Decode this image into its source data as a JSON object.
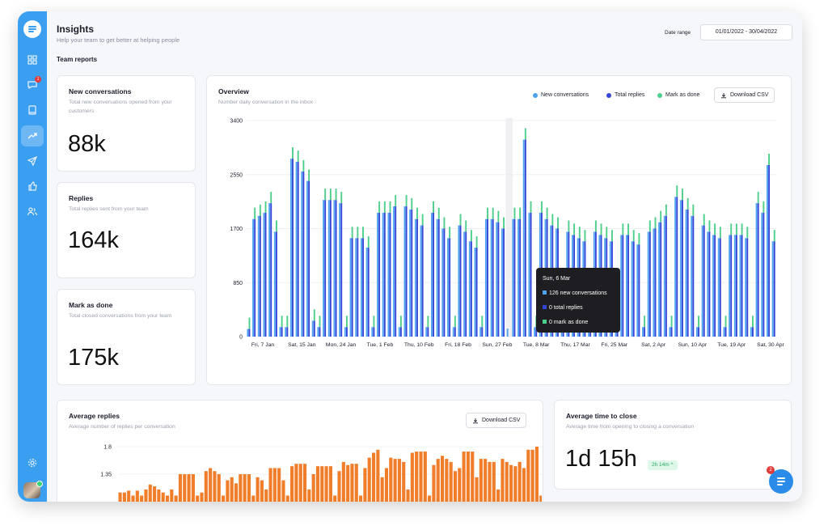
{
  "page": {
    "title": "Insights",
    "subtitle": "Help your team to get better at helping people",
    "section_title": "Team reports"
  },
  "date_range": {
    "label": "Date range",
    "value": "01/01/2022 - 30/04/2022"
  },
  "sidebar": {
    "items": [
      {
        "icon": "grid-icon",
        "badge": ""
      },
      {
        "icon": "chat-icon",
        "badge": "1"
      },
      {
        "icon": "book-icon",
        "badge": ""
      },
      {
        "icon": "trend-icon",
        "badge": ""
      },
      {
        "icon": "send-icon",
        "badge": ""
      },
      {
        "icon": "thumbs-up-icon",
        "badge": ""
      },
      {
        "icon": "users-icon",
        "badge": ""
      }
    ],
    "active": "trend-icon"
  },
  "stats": [
    {
      "title": "New conversations",
      "desc": "Total new conversations opened from your customers",
      "value": "88k"
    },
    {
      "title": "Replies",
      "desc": "Total replies sent from your team",
      "value": "164k"
    },
    {
      "title": "Mark as done",
      "desc": "Total closed conversations from your team",
      "value": "175k"
    }
  ],
  "overview": {
    "title": "Overview",
    "subtitle": "Number daily conversation in the inbox",
    "download_label": "Download CSV"
  },
  "tooltip": {
    "title": "Sun, 6 Mar",
    "rows": [
      "126 new conversations",
      "0 total replies",
      "0 mark as done"
    ]
  },
  "avg_replies": {
    "title": "Average replies",
    "subtitle": "Average number of replies per conversation",
    "download_label": "Download CSV"
  },
  "avg_close": {
    "title": "Average time to close",
    "subtitle": "Average time from opening to closing a conversation",
    "value": "1d 15h",
    "change": "2h 14m ^"
  },
  "chat_widget": {
    "badge": "2"
  },
  "colors": {
    "new": "#4da3f0",
    "replies": "#3545d8",
    "done": "#4ccf8a",
    "orange": "#f07d2a",
    "brand": "#3b9ff0"
  },
  "chart_data": [
    {
      "type": "bar",
      "title": "Overview",
      "subtitle": "Number daily conversation in the inbox",
      "legend": [
        "New conversations",
        "Total replies",
        "Mark as done"
      ],
      "legend_position": "top-right",
      "ylim": [
        0,
        3400
      ],
      "yticks": [
        0,
        850,
        1700,
        2550,
        3400
      ],
      "xtick_labels": [
        "Fri, 7 Jan",
        "Sat, 15 Jan",
        "Mon, 24 Jan",
        "Tue, 1 Feb",
        "Thu, 10 Feb",
        "Fri, 18 Feb",
        "Sun, 27 Feb",
        "Tue, 8 Mar",
        "Thu, 17 Mar",
        "Fri, 25 Mar",
        "Sat, 2 Apr",
        "Sun, 10 Apr",
        "Tue, 19 Apr",
        "Sat, 30 Apr"
      ],
      "grid": true,
      "series": [
        {
          "name": "New conversations",
          "values": [
            120,
            1850,
            1900,
            1950,
            2100,
            1650,
            150,
            150,
            2800,
            2750,
            2600,
            2450,
            250,
            150,
            2150,
            2150,
            2150,
            2100,
            150,
            1550,
            1550,
            1550,
            1400,
            150,
            1950,
            1950,
            1950,
            2050,
            150,
            2050,
            2000,
            1850,
            1750,
            150,
            1950,
            1850,
            1700,
            1550,
            150,
            1750,
            1650,
            1500,
            1400,
            150,
            1850,
            1850,
            1800,
            1700,
            126,
            1850,
            1850,
            3100,
            1950,
            150,
            1950,
            1850,
            1750,
            1700,
            150,
            1650,
            1600,
            1550,
            1500,
            150,
            1650,
            1600,
            1550,
            1500,
            150,
            1600,
            1600,
            1500,
            1450,
            150,
            1650,
            1700,
            1800,
            1900,
            150,
            2200,
            2150,
            2000,
            1900,
            150,
            1750,
            1650,
            1600,
            1550,
            150,
            1600,
            1600,
            1600,
            1550,
            150,
            2100,
            1950,
            2700,
            1500
          ]
        },
        {
          "name": "Total replies",
          "values": [
            120,
            1850,
            1900,
            1950,
            2100,
            1650,
            150,
            150,
            2800,
            2750,
            2600,
            2450,
            250,
            150,
            2150,
            2150,
            2150,
            2100,
            150,
            1550,
            1550,
            1550,
            1400,
            150,
            1950,
            1950,
            1950,
            2050,
            150,
            2050,
            2000,
            1850,
            1750,
            150,
            1950,
            1850,
            1700,
            1550,
            150,
            1750,
            1650,
            1500,
            1400,
            150,
            1850,
            1850,
            1800,
            1700,
            0,
            1850,
            1850,
            3100,
            1950,
            150,
            1950,
            1850,
            1750,
            1700,
            150,
            1650,
            1600,
            1550,
            1500,
            150,
            1650,
            1600,
            1550,
            1500,
            150,
            1600,
            1600,
            1500,
            1450,
            150,
            1650,
            1700,
            1800,
            1900,
            150,
            2200,
            2150,
            2000,
            1900,
            150,
            1750,
            1650,
            1600,
            1550,
            150,
            1600,
            1600,
            1600,
            1550,
            150,
            2100,
            1950,
            2700,
            1500
          ]
        },
        {
          "name": "Mark as done",
          "values": [
            120,
            1850,
            1900,
            1950,
            2100,
            1650,
            150,
            150,
            2800,
            2750,
            2600,
            2450,
            250,
            150,
            2150,
            2150,
            2150,
            2100,
            150,
            1550,
            1550,
            1550,
            1400,
            150,
            1950,
            1950,
            1950,
            2050,
            150,
            2050,
            2000,
            1850,
            1750,
            150,
            1950,
            1850,
            1700,
            1550,
            150,
            1750,
            1650,
            1500,
            1400,
            150,
            1850,
            1850,
            1800,
            1700,
            0,
            1850,
            1850,
            3100,
            1950,
            150,
            1950,
            1850,
            1750,
            1700,
            150,
            1650,
            1600,
            1550,
            1500,
            150,
            1650,
            1600,
            1550,
            1500,
            150,
            1600,
            1600,
            1500,
            1450,
            150,
            1650,
            1700,
            1800,
            1900,
            150,
            2200,
            2150,
            2000,
            1900,
            150,
            1750,
            1650,
            1600,
            1550,
            150,
            1600,
            1600,
            1600,
            1550,
            150,
            2100,
            1950,
            2700,
            1500
          ]
        }
      ],
      "tooltip_label": "Sun, 6 Mar"
    },
    {
      "type": "bar",
      "title": "Average replies",
      "subtitle": "Average number of replies per conversation",
      "yticks": [
        1.35,
        1.8
      ],
      "ylim": [
        0.9,
        1.85
      ],
      "series": [
        {
          "name": "",
          "values": [
            1.05,
            1.05,
            1.08,
            1.0,
            1.08,
            1.0,
            1.1,
            1.18,
            1.15,
            1.1,
            1.05,
            1.0,
            1.1,
            1.0,
            1.35,
            1.35,
            1.35,
            1.35,
            1.0,
            1.05,
            1.4,
            1.45,
            1.4,
            1.35,
            1.0,
            1.25,
            1.3,
            1.2,
            1.35,
            1.35,
            1.35,
            1.0,
            1.3,
            1.25,
            1.1,
            1.45,
            1.45,
            1.45,
            1.25,
            1.0,
            1.48,
            1.52,
            1.52,
            1.52,
            1.1,
            1.35,
            1.48,
            1.48,
            1.48,
            1.48,
            1.0,
            1.4,
            1.55,
            1.5,
            1.52,
            1.52,
            1.0,
            1.45,
            1.62,
            1.7,
            1.75,
            1.3,
            1.45,
            1.62,
            1.6,
            1.6,
            1.55,
            1.1,
            1.7,
            1.72,
            1.72,
            1.72,
            1.0,
            1.5,
            1.6,
            1.65,
            1.6,
            1.55,
            1.4,
            1.45,
            1.72,
            1.72,
            1.72,
            1.3,
            1.6,
            1.6,
            1.55,
            1.55,
            1.1,
            1.6,
            1.55,
            1.5,
            1.48,
            1.55,
            1.45,
            1.75,
            1.75,
            1.8,
            1.0
          ]
        }
      ]
    }
  ]
}
